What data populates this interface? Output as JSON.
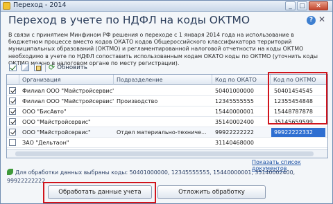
{
  "window": {
    "title": "Переход - 2014",
    "heading": "Переход в учете по НДФЛ на коды ОКТМО",
    "help_label": "?",
    "close_label": "✕"
  },
  "info_text": "В связи с принятием Минфином РФ решения о переходе с 1 января 2014 года на использование в бюджетном процессе вместо кодов ОКАТО кодов Общероссийского классификатора территорий муниципальных образований (ОКТМО) и регламентированной налоговой отчетности на коды ОКТМО необходимо в учете по НДФЛ сопоставить использованным кодам ОКАТО коды по ОКТМО (уточнить коды ОКТМО можно в налоговом органе по месту регистрации).",
  "toolbar": {
    "refresh_label": "Обновить"
  },
  "table": {
    "columns": [
      "Организация",
      "Подразделение",
      "Код по ОКАТО",
      "Код по ОКТМО"
    ],
    "rows": [
      {
        "checked": true,
        "org": "Филиал ООО \"Майстройсервис\" в г. Нов...",
        "dept": "",
        "okato": "50401000000",
        "oktmo": "50401454545"
      },
      {
        "checked": true,
        "org": "Филиал ООО \"Майстройсервис\" в г. Нов...",
        "dept": "Производство",
        "okato": "12345555555",
        "oktmo": "12355454848"
      },
      {
        "checked": true,
        "org": "ООО \"БисАвто\"",
        "dept": "",
        "okato": "15440000001",
        "oktmo": "15448787878"
      },
      {
        "checked": true,
        "org": "ООО \"Майстройсервис\"",
        "dept": "",
        "okato": "35140002400",
        "oktmo": "35145659599"
      },
      {
        "checked": true,
        "org": "ООО \"Майстройсервис\"",
        "dept": "Отдел материально-техниче...",
        "okato": "99922222222",
        "oktmo": "99922222332"
      },
      {
        "checked": false,
        "org": "ЗАО \"Дельтаон\"",
        "dept": "",
        "okato": "31140468000",
        "oktmo": ""
      }
    ]
  },
  "links": {
    "show_docs": "Показать список документов"
  },
  "status_text": "Для обработки данных выбраны коды: 50401000000, 12345555555, 15440000001, 35140002400, 99922222222",
  "buttons": {
    "process": "Обработать данные учета",
    "defer": "Отложить обработку"
  },
  "colors": {
    "highlight": "#d0141c",
    "selection": "#2f6fd1"
  }
}
